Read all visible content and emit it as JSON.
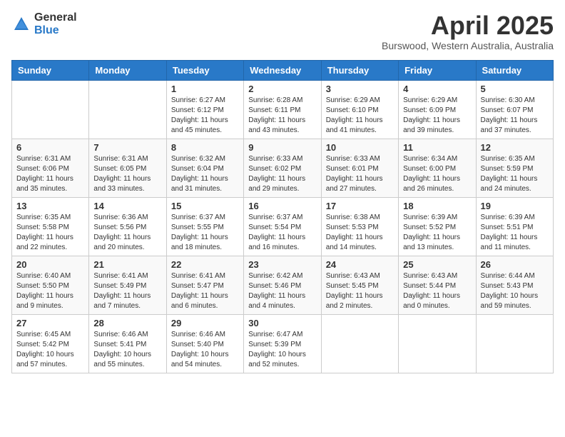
{
  "logo": {
    "general": "General",
    "blue": "Blue"
  },
  "title": {
    "month": "April 2025",
    "location": "Burswood, Western Australia, Australia"
  },
  "calendar": {
    "headers": [
      "Sunday",
      "Monday",
      "Tuesday",
      "Wednesday",
      "Thursday",
      "Friday",
      "Saturday"
    ],
    "weeks": [
      [
        {
          "day": "",
          "info": ""
        },
        {
          "day": "",
          "info": ""
        },
        {
          "day": "1",
          "info": "Sunrise: 6:27 AM\nSunset: 6:12 PM\nDaylight: 11 hours and 45 minutes."
        },
        {
          "day": "2",
          "info": "Sunrise: 6:28 AM\nSunset: 6:11 PM\nDaylight: 11 hours and 43 minutes."
        },
        {
          "day": "3",
          "info": "Sunrise: 6:29 AM\nSunset: 6:10 PM\nDaylight: 11 hours and 41 minutes."
        },
        {
          "day": "4",
          "info": "Sunrise: 6:29 AM\nSunset: 6:09 PM\nDaylight: 11 hours and 39 minutes."
        },
        {
          "day": "5",
          "info": "Sunrise: 6:30 AM\nSunset: 6:07 PM\nDaylight: 11 hours and 37 minutes."
        }
      ],
      [
        {
          "day": "6",
          "info": "Sunrise: 6:31 AM\nSunset: 6:06 PM\nDaylight: 11 hours and 35 minutes."
        },
        {
          "day": "7",
          "info": "Sunrise: 6:31 AM\nSunset: 6:05 PM\nDaylight: 11 hours and 33 minutes."
        },
        {
          "day": "8",
          "info": "Sunrise: 6:32 AM\nSunset: 6:04 PM\nDaylight: 11 hours and 31 minutes."
        },
        {
          "day": "9",
          "info": "Sunrise: 6:33 AM\nSunset: 6:02 PM\nDaylight: 11 hours and 29 minutes."
        },
        {
          "day": "10",
          "info": "Sunrise: 6:33 AM\nSunset: 6:01 PM\nDaylight: 11 hours and 27 minutes."
        },
        {
          "day": "11",
          "info": "Sunrise: 6:34 AM\nSunset: 6:00 PM\nDaylight: 11 hours and 26 minutes."
        },
        {
          "day": "12",
          "info": "Sunrise: 6:35 AM\nSunset: 5:59 PM\nDaylight: 11 hours and 24 minutes."
        }
      ],
      [
        {
          "day": "13",
          "info": "Sunrise: 6:35 AM\nSunset: 5:58 PM\nDaylight: 11 hours and 22 minutes."
        },
        {
          "day": "14",
          "info": "Sunrise: 6:36 AM\nSunset: 5:56 PM\nDaylight: 11 hours and 20 minutes."
        },
        {
          "day": "15",
          "info": "Sunrise: 6:37 AM\nSunset: 5:55 PM\nDaylight: 11 hours and 18 minutes."
        },
        {
          "day": "16",
          "info": "Sunrise: 6:37 AM\nSunset: 5:54 PM\nDaylight: 11 hours and 16 minutes."
        },
        {
          "day": "17",
          "info": "Sunrise: 6:38 AM\nSunset: 5:53 PM\nDaylight: 11 hours and 14 minutes."
        },
        {
          "day": "18",
          "info": "Sunrise: 6:39 AM\nSunset: 5:52 PM\nDaylight: 11 hours and 13 minutes."
        },
        {
          "day": "19",
          "info": "Sunrise: 6:39 AM\nSunset: 5:51 PM\nDaylight: 11 hours and 11 minutes."
        }
      ],
      [
        {
          "day": "20",
          "info": "Sunrise: 6:40 AM\nSunset: 5:50 PM\nDaylight: 11 hours and 9 minutes."
        },
        {
          "day": "21",
          "info": "Sunrise: 6:41 AM\nSunset: 5:49 PM\nDaylight: 11 hours and 7 minutes."
        },
        {
          "day": "22",
          "info": "Sunrise: 6:41 AM\nSunset: 5:47 PM\nDaylight: 11 hours and 6 minutes."
        },
        {
          "day": "23",
          "info": "Sunrise: 6:42 AM\nSunset: 5:46 PM\nDaylight: 11 hours and 4 minutes."
        },
        {
          "day": "24",
          "info": "Sunrise: 6:43 AM\nSunset: 5:45 PM\nDaylight: 11 hours and 2 minutes."
        },
        {
          "day": "25",
          "info": "Sunrise: 6:43 AM\nSunset: 5:44 PM\nDaylight: 11 hours and 0 minutes."
        },
        {
          "day": "26",
          "info": "Sunrise: 6:44 AM\nSunset: 5:43 PM\nDaylight: 10 hours and 59 minutes."
        }
      ],
      [
        {
          "day": "27",
          "info": "Sunrise: 6:45 AM\nSunset: 5:42 PM\nDaylight: 10 hours and 57 minutes."
        },
        {
          "day": "28",
          "info": "Sunrise: 6:46 AM\nSunset: 5:41 PM\nDaylight: 10 hours and 55 minutes."
        },
        {
          "day": "29",
          "info": "Sunrise: 6:46 AM\nSunset: 5:40 PM\nDaylight: 10 hours and 54 minutes."
        },
        {
          "day": "30",
          "info": "Sunrise: 6:47 AM\nSunset: 5:39 PM\nDaylight: 10 hours and 52 minutes."
        },
        {
          "day": "",
          "info": ""
        },
        {
          "day": "",
          "info": ""
        },
        {
          "day": "",
          "info": ""
        }
      ]
    ]
  }
}
